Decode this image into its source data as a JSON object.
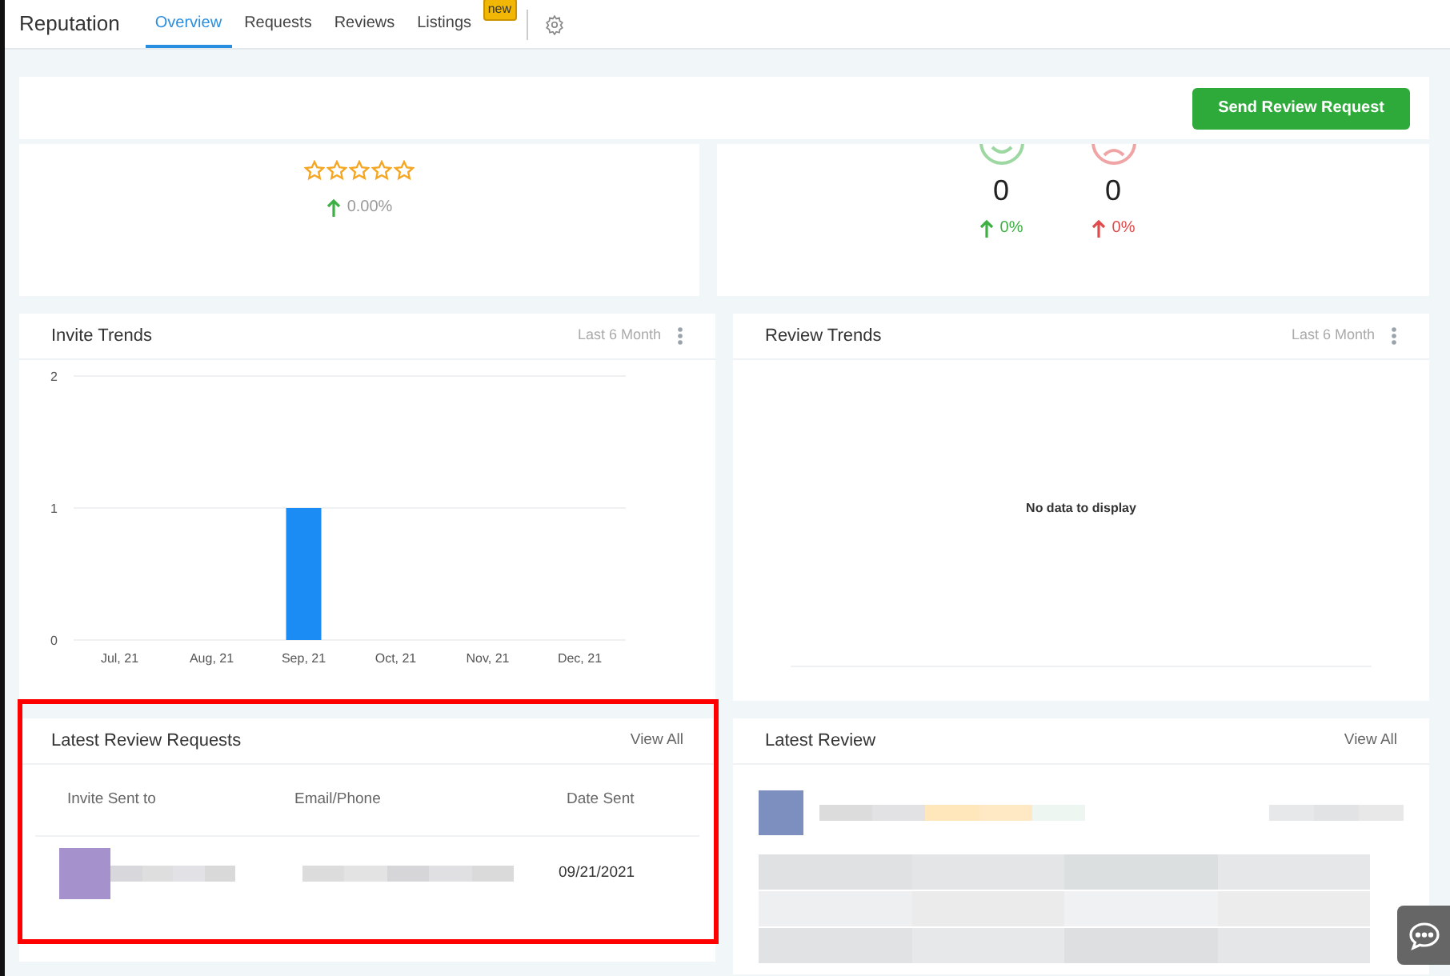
{
  "header": {
    "title": "Reputation",
    "tabs": [
      {
        "label": "Overview",
        "selected": true
      },
      {
        "label": "Requests",
        "selected": false
      },
      {
        "label": "Reviews",
        "selected": false
      },
      {
        "label": "Listings",
        "selected": false,
        "badge": "new"
      }
    ]
  },
  "action_button": "Send Review Request",
  "rating_card": {
    "stars": 0,
    "change": "0.00%"
  },
  "sentiment_card": {
    "items": [
      {
        "kind": "positive",
        "count": "0",
        "change": "0%",
        "color": "#3cb043"
      },
      {
        "kind": "negative",
        "count": "0",
        "change": "0%",
        "color": "#e04b4b"
      }
    ]
  },
  "invite_trends": {
    "title": "Invite Trends",
    "period": "Last 6 Month",
    "chart_data": {
      "type": "bar",
      "categories": [
        "Jul, 21",
        "Aug, 21",
        "Sep, 21",
        "Oct, 21",
        "Nov, 21",
        "Dec, 21"
      ],
      "values": [
        0,
        0,
        1,
        0,
        0,
        0
      ],
      "ylim": [
        0,
        2
      ],
      "yticks": [
        0,
        1,
        2
      ]
    }
  },
  "review_trends": {
    "title": "Review Trends",
    "period": "Last 6 Month",
    "empty_message": "No data to display"
  },
  "latest_requests": {
    "title": "Latest Review Requests",
    "link": "View All",
    "highlighted": true,
    "columns": [
      "Invite Sent to",
      "Email/Phone",
      "Date Sent"
    ],
    "rows": [
      {
        "date": "09/21/2021"
      }
    ]
  },
  "latest_review": {
    "title": "Latest Review",
    "link": "View All"
  }
}
